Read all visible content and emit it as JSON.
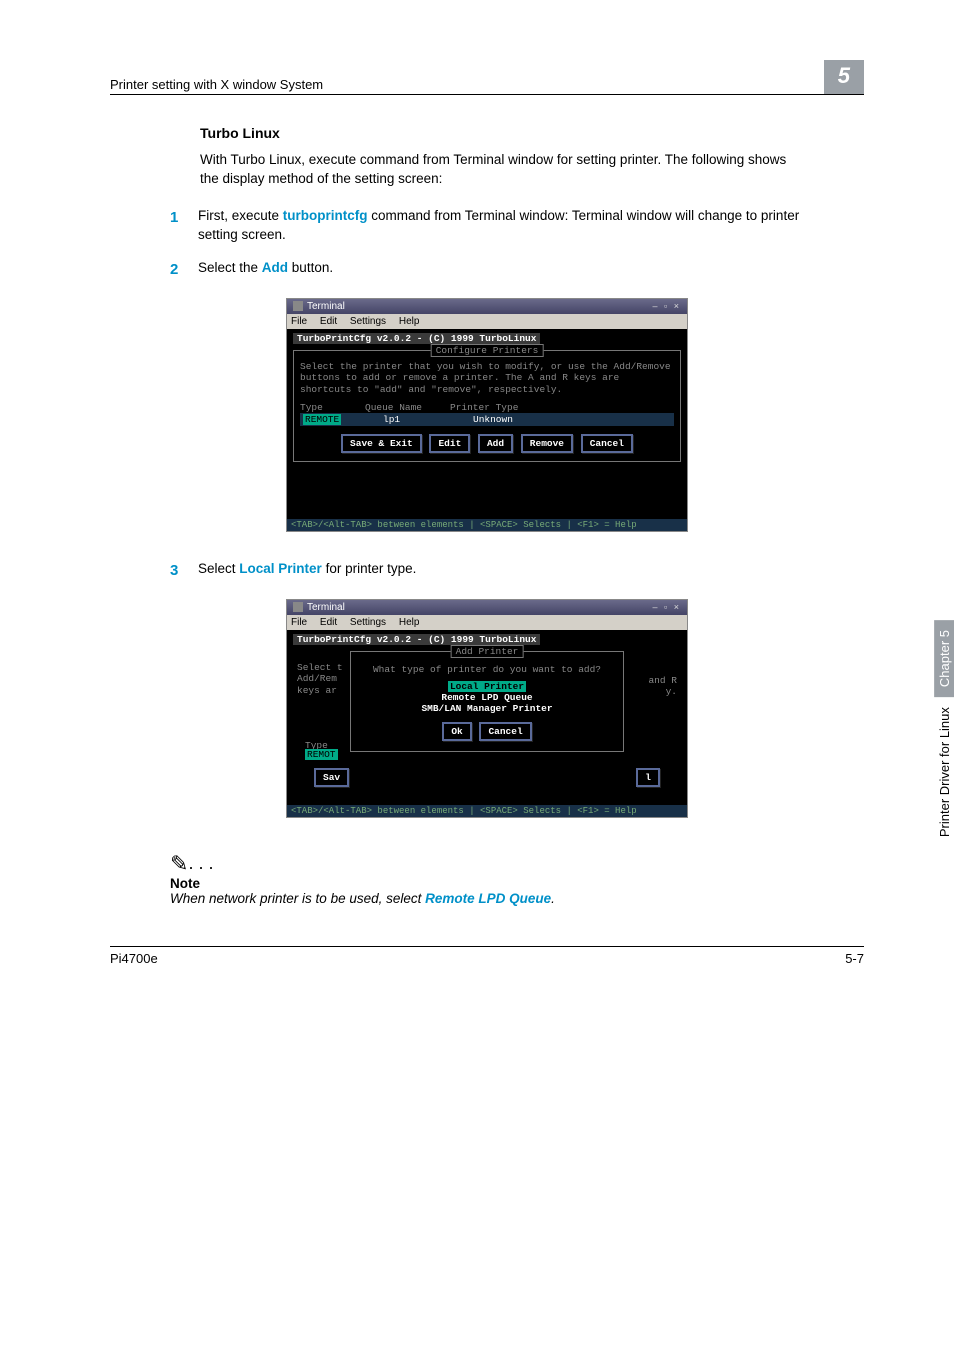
{
  "header": {
    "left": "Printer setting with X window System",
    "chapter_num": "5"
  },
  "section": {
    "title": "Turbo Linux",
    "intro": "With Turbo Linux, execute command from Terminal window for setting printer. The following shows the display method of the setting screen:"
  },
  "steps": {
    "s1_num": "1",
    "s1_pre": "First, execute ",
    "s1_cmd": "turboprintcfg",
    "s1_post": " command from Terminal window: Terminal window will change to printer setting screen.",
    "s2_num": "2",
    "s2_pre": "Select the ",
    "s2_cmd": "Add",
    "s2_post": " button.",
    "s3_num": "3",
    "s3_pre": "Select ",
    "s3_cmd": "Local Printer",
    "s3_post": " for printer type."
  },
  "shot1": {
    "title": "Terminal",
    "menu": {
      "m1": "File",
      "m2": "Edit",
      "m3": "Settings",
      "m4": "Help"
    },
    "toprow": "TurboPrintCfg v2.0.2 - (C) 1999 TurboLinux",
    "dialog_title": "Configure Printers",
    "instr": "Select the printer that you wish to modify, or use the Add/Remove buttons to add or remove a printer.  The A and R keys are shortcuts to \"add\" and \"remove\", respectively.",
    "th1": "Type",
    "th2": "Queue Name",
    "th3": "Printer Type",
    "r1c1": "REMOTE",
    "r1c2": "lp1",
    "r1c3": "Unknown",
    "b1": "Save & Exit",
    "b2": "Edit",
    "b3": "Add",
    "b4": "Remove",
    "b5": "Cancel",
    "footer": "<TAB>/<Alt-TAB> between elements   |   <SPACE> Selects  |  <F1> = Help"
  },
  "shot2": {
    "title": "Terminal",
    "menu": {
      "m1": "File",
      "m2": "Edit",
      "m3": "Settings",
      "m4": "Help"
    },
    "toprow": "TurboPrintCfg v2.0.2 - (C) 1999 TurboLinux",
    "dialog_title": "Add Printer",
    "prompt": "What type of printer do you want to add?",
    "opt1": "Local Printer",
    "opt2": "Remote LPD Queue",
    "opt3": "SMB/LAN Manager Printer",
    "ok": "Ok",
    "cancel": "Cancel",
    "side_l1": "Select t",
    "side_l2": "Add/Rem",
    "side_l3": "keys ar",
    "side_r1": "and R",
    "side_r2": "y.",
    "bl_type": "Type",
    "bl_remot": "REMOT",
    "sav": "Sav",
    "one": "l",
    "footer": "<TAB>/<Alt-TAB> between elements   |   <SPACE> Selects  |  <F1> = Help"
  },
  "note": {
    "icon": "✎",
    "dots": ". . .",
    "label": "Note",
    "text_pre": "When network printer is to be used, select ",
    "text_cmd": "Remote LPD Queue",
    "text_post": "."
  },
  "sidebar": {
    "left": "Printer Driver for Linux",
    "right": "Chapter 5"
  },
  "footer": {
    "left": "Pi4700e",
    "right": "5-7"
  }
}
